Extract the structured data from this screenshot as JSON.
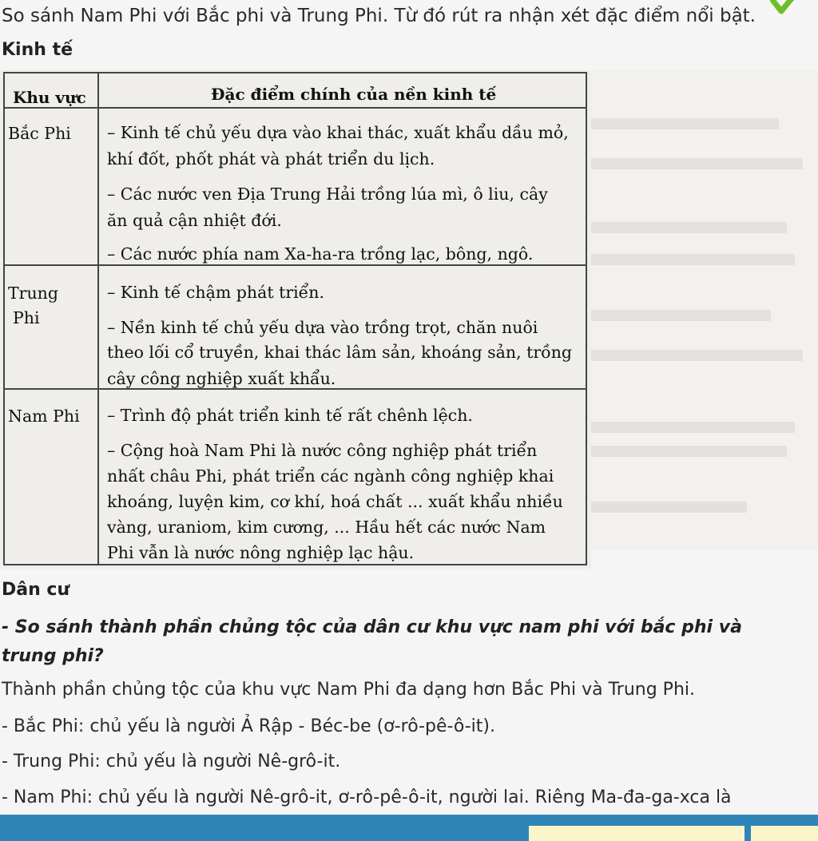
{
  "question": "So sánh Nam Phi với Bắc phi và Trung Phi. Từ đó rút ra nhận xét đặc điểm nổi bật.",
  "sections": {
    "economy_heading": "Kinh tế",
    "population_heading": "Dân cư"
  },
  "table": {
    "headers": [
      "Khu vực",
      "Đặc điểm chính của nền kinh tế"
    ],
    "rows": [
      {
        "region_lines": [
          "Bắc Phi"
        ],
        "lines": [
          "– Kinh tế chủ yếu dựa vào khai thác, xuất khẩu dầu mỏ,",
          "khí đốt, phốt phát và phát triển du lịch.",
          "– Các nước ven Địa Trung Hải trồng lúa mì, ô liu, cây",
          "ăn quả cận nhiệt đới.",
          "– Các nước phía nam Xa-ha-ra trồng lạc, bông, ngô."
        ]
      },
      {
        "region_lines": [
          "Trung",
          "Phi"
        ],
        "lines": [
          "– Kinh tế chậm phát triển.",
          "– Nền kinh tế chủ yếu dựa vào trồng trọt, chăn nuôi",
          "theo lối cổ truyền, khai thác lâm sản, khoáng sản, trồng",
          "cây công nghiệp xuất khẩu."
        ]
      },
      {
        "region_lines": [
          "Nam Phi"
        ],
        "lines": [
          "– Trình độ phát triển kinh tế rất chênh lệch.",
          "– Cộng hoà Nam Phi là nước công nghiệp phát triển",
          "nhất châu Phi, phát triển các ngành công nghiệp khai",
          "khoáng, luyện kim, cơ khí, hoá chất ... xuất khẩu nhiều",
          "vàng, uraniom, kim cương, ... Hầu hết các nước Nam",
          "Phi vẫn là nước nông nghiệp lạc hậu."
        ]
      }
    ]
  },
  "population": {
    "sub_question": "- So sánh thành phần chủng tộc của dân cư khu vực nam phi với bắc phi và trung phi?",
    "lines": [
      "Thành phần chủng tộc của khu vực Nam Phi đa dạng hơn Bắc Phi và Trung Phi.",
      "- Bắc Phi: chủ yếu là người Ả Rập - Béc-be (ơ-rô-pê-ô-it).",
      "- Trung Phi: chủ yếu là người Nê-grô-it.",
      "- Nam Phi: chủ yếu là người Nê-grô-it, ơ-rô-pê-ô-it, người lai. Riêng Ma-đa-ga-xca là"
    ]
  },
  "icons": {
    "check": "check-icon"
  },
  "colors": {
    "check_green": "#6cbf2a",
    "bottom_bar": "#2f85b8",
    "bar_button": "#fbf6c9"
  }
}
